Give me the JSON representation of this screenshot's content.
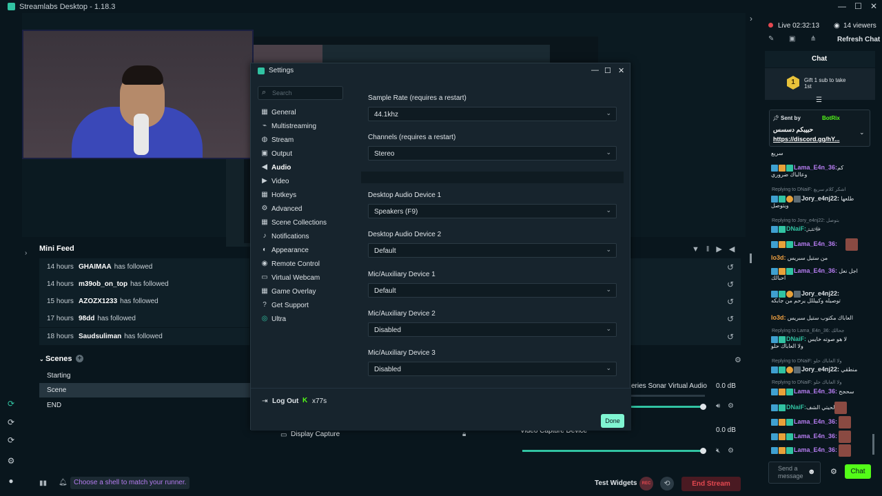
{
  "window": {
    "title": "Streamlabs Desktop - 1.18.3"
  },
  "rail": {
    "icons": [
      "studio-icon",
      "themes-icon",
      "apps-icon",
      "settings-icon",
      "profile-icon"
    ]
  },
  "minifeed": {
    "title": "Mini Feed",
    "rows": [
      {
        "time": "14 hours",
        "name": "GHAIMAA",
        "action": "has followed"
      },
      {
        "time": "14 hours",
        "name": "m39ob_on_top",
        "action": "has followed"
      },
      {
        "time": "15 hours",
        "name": "AZOZX1233",
        "action": "has followed"
      },
      {
        "time": "17 hours",
        "name": "98dd",
        "action": "has followed"
      },
      {
        "time": "18 hours",
        "name": "Saudsuliman",
        "action": "has followed"
      }
    ]
  },
  "scenes": {
    "title": "Scenes",
    "items": [
      "Starting",
      "Scene",
      "END"
    ],
    "selected": 1
  },
  "sources": {
    "display_capture": "Display Capture"
  },
  "mixer": {
    "device1": "eries Sonar Virtual Audio...",
    "device1_db": "0.0 dB",
    "device2": "Video Capture Device",
    "device2_db": "0.0 dB"
  },
  "footer": {
    "notice": "Choose a shell to match your runner.",
    "test_widgets": "Test Widgets",
    "end_stream": "End Stream"
  },
  "settings": {
    "title": "Settings",
    "search_placeholder": "Search",
    "nav": [
      "General",
      "Multistreaming",
      "Stream",
      "Output",
      "Audio",
      "Video",
      "Hotkeys",
      "Advanced",
      "Scene Collections",
      "Notifications",
      "Appearance",
      "Remote Control",
      "Virtual Webcam",
      "Game Overlay",
      "Get Support",
      "Ultra"
    ],
    "active": "Audio",
    "fields": [
      {
        "label": "Sample Rate (requires a restart)",
        "value": "44.1khz"
      },
      {
        "label": "Channels (requires a restart)",
        "value": "Stereo"
      },
      {
        "label": "Desktop Audio Device 1",
        "value": "Speakers (F9)"
      },
      {
        "label": "Desktop Audio Device 2",
        "value": "Default"
      },
      {
        "label": "Mic/Auxiliary Device 1",
        "value": "Default"
      },
      {
        "label": "Mic/Auxiliary Device 2",
        "value": "Disabled"
      },
      {
        "label": "Mic/Auxiliary Device 3",
        "value": "Disabled"
      }
    ],
    "logout": "Log Out",
    "user": "x77s",
    "done": "Done"
  },
  "chat": {
    "status": "Live 02:32:13",
    "viewers": "14 viewers",
    "refresh": "Refresh Chat",
    "title": "Chat",
    "gift": "Gift 1 sub to take 1st",
    "pinned_by": "Sent by",
    "pinned_user": "BotRix",
    "pinned_text": "حبيبكم دسسس",
    "pinned_link": "https://discord.gg/hY...",
    "input_placeholder": "Send a message",
    "send": "Chat",
    "messages": [
      {
        "user": "",
        "text": "سريع",
        "color": "#dfe4e8"
      },
      {
        "user": "Lama_E4n_36:",
        "text": "كم",
        "color": "#b57cf0",
        "text2": "وعالباك ضروري"
      },
      {
        "reply": "Replying to DNaiF: اشكر كلام سريع"
      },
      {
        "user": "Jory_e4nj22:",
        "text": "طلعها",
        "color": "#dfe4e8",
        "text2": "وبتوصل"
      },
      {
        "reply": "Replying to Jory_e4nj22: بتوصل"
      },
      {
        "user": "DNaiF:",
        "text": "ﷻلللبش",
        "color": "#31c3a2"
      },
      {
        "user": "Lama_E4n_36:",
        "text": "",
        "color": "#b57cf0"
      },
      {
        "user": "lo3d:",
        "text": "من ستيل سبريس",
        "color": "#f0a040"
      },
      {
        "user": "Lama_E4n_36:",
        "text": "اجل نعل",
        "color": "#b57cf0",
        "text2": "احبالك"
      },
      {
        "user": "Jory_e4nj22:",
        "text": "",
        "color": "#dfe4e8",
        "text2": "توصيله وكييللل يرحم من جابكه"
      },
      {
        "user": "lo3d:",
        "text": "العاباك مكتوب ستيل سبريس",
        "color": "#f0a040"
      },
      {
        "reply": "Replying to Lama_E4n_36: جحالك"
      },
      {
        "user": "DNaiF:",
        "text": "لا هو صوته خايس",
        "color": "#31c3a2",
        "text2": "ولا العاباك حلو"
      },
      {
        "reply": "Replying to DNaiF: ولا العاباك حلو"
      },
      {
        "user": "Jory_e4nj22:",
        "text": "منطقي",
        "color": "#dfe4e8"
      },
      {
        "reply": "Replying to DNaiF: ولا العاباك حلو"
      },
      {
        "user": "Lama_E4n_36:",
        "text": "سحجح",
        "color": "#b57cf0"
      },
      {
        "user": "DNaiF:",
        "text": "لحيتي الشف",
        "color": "#31c3a2"
      },
      {
        "user": "Lama_E4n_36:",
        "text": "",
        "color": "#b57cf0"
      },
      {
        "user": "Lama_E4n_36:",
        "text": "",
        "color": "#b57cf0"
      },
      {
        "user": "Lama_E4n_36:",
        "text": "",
        "color": "#b57cf0"
      }
    ]
  }
}
